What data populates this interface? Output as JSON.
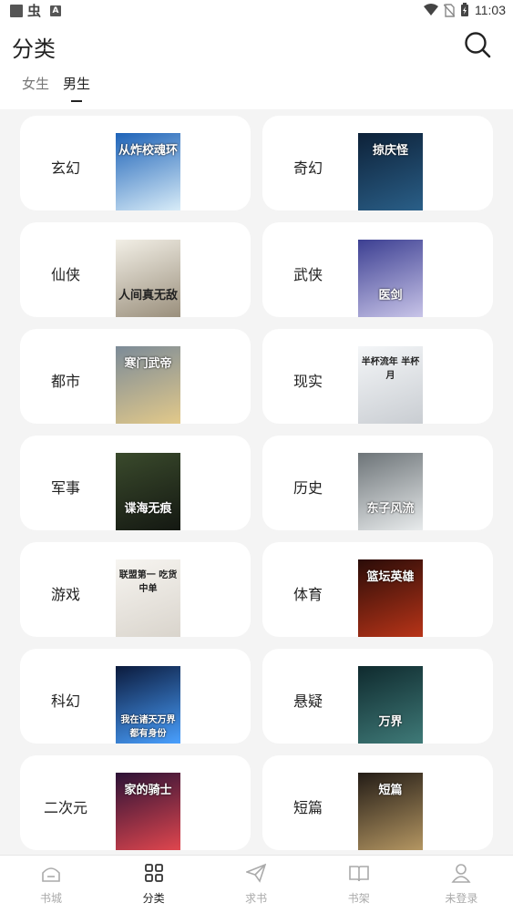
{
  "status_bar": {
    "time": "11:03",
    "a_badge": "A",
    "bug_glyph": "虫"
  },
  "header": {
    "title": "分类"
  },
  "tabs": [
    {
      "label": "女生",
      "active": false
    },
    {
      "label": "男生",
      "active": true
    }
  ],
  "categories": [
    {
      "label": "玄幻",
      "cover_text": "从炸校魂环",
      "cover_colors": [
        "#1e63b8",
        "#d8ecf8"
      ]
    },
    {
      "label": "奇幻",
      "cover_text": "掠庆怪",
      "cover_colors": [
        "#0d2138",
        "#2a5f88"
      ]
    },
    {
      "label": "仙侠",
      "cover_text": "人间真无敌",
      "cover_colors": [
        "#f2efe6",
        "#9a8f7c"
      ]
    },
    {
      "label": "武侠",
      "cover_text": "医剑",
      "cover_colors": [
        "#3c3f92",
        "#c8c4e8"
      ]
    },
    {
      "label": "都市",
      "cover_text": "寒门武帝",
      "cover_colors": [
        "#7c8b98",
        "#e2c98a"
      ]
    },
    {
      "label": "现实",
      "cover_text": "半杯流年 半杯月",
      "cover_colors": [
        "#f4f6f8",
        "#c9cdd2"
      ]
    },
    {
      "label": "军事",
      "cover_text": "谍海无痕",
      "cover_colors": [
        "#3a4a2c",
        "#141812"
      ]
    },
    {
      "label": "历史",
      "cover_text": "东子风流",
      "cover_colors": [
        "#6d7478",
        "#e8ebec"
      ]
    },
    {
      "label": "游戏",
      "cover_text": "联盟第一 吃货中单",
      "cover_colors": [
        "#f7f5f1",
        "#d9d4cc"
      ]
    },
    {
      "label": "体育",
      "cover_text": "篮坛英雄",
      "cover_colors": [
        "#2a0c08",
        "#b83418"
      ]
    },
    {
      "label": "科幻",
      "cover_text": "我在诸天万界 都有身份",
      "cover_colors": [
        "#0b1a3c",
        "#49a0ff"
      ]
    },
    {
      "label": "悬疑",
      "cover_text": "万界",
      "cover_colors": [
        "#0f2a2e",
        "#3f7a78"
      ]
    },
    {
      "label": "二次元",
      "cover_text": "家的骑士",
      "cover_colors": [
        "#2c1236",
        "#e0464e"
      ]
    },
    {
      "label": "短篇",
      "cover_text": "短篇",
      "cover_colors": [
        "#231c16",
        "#b49662"
      ]
    }
  ],
  "nav": [
    {
      "label": "书城",
      "icon": "home-icon",
      "active": false
    },
    {
      "label": "分类",
      "icon": "grid-icon",
      "active": true
    },
    {
      "label": "求书",
      "icon": "paper-plane-icon",
      "active": false
    },
    {
      "label": "书架",
      "icon": "book-icon",
      "active": false
    },
    {
      "label": "未登录",
      "icon": "user-icon",
      "active": false
    }
  ]
}
